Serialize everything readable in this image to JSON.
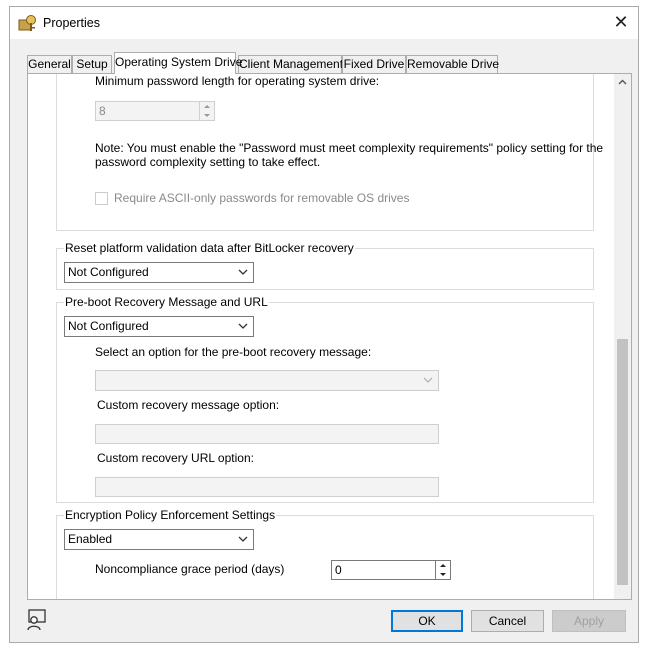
{
  "window": {
    "title": "Properties",
    "close_label": "✕"
  },
  "tabs": [
    {
      "label": "General"
    },
    {
      "label": "Setup"
    },
    {
      "label": "Operating System Drive"
    },
    {
      "label": "Client Management"
    },
    {
      "label": "Fixed Drive"
    },
    {
      "label": "Removable Drive"
    }
  ],
  "password": {
    "label": "Minimum password length for operating system drive:",
    "value": "8",
    "note": "Note: You must enable the \"Password must meet complexity requirements\" policy setting for the password complexity setting to take effect.",
    "ascii_checkbox_label": "Require ASCII-only passwords for removable OS drives"
  },
  "reset_platform": {
    "legend": "Reset platform validation data after BitLocker recovery",
    "value": "Not Configured"
  },
  "preboot": {
    "legend": "Pre-boot Recovery Message and URL",
    "value": "Not Configured",
    "select_label": "Select an option for the pre-boot recovery message:",
    "select_value": "",
    "message_label": "Custom recovery message option:",
    "message_value": "",
    "url_label": "Custom recovery URL option:",
    "url_value": ""
  },
  "encryption": {
    "legend": "Encryption Policy Enforcement Settings",
    "value": "Enabled",
    "grace_label": "Noncompliance grace period (days)",
    "grace_value": "0"
  },
  "buttons": {
    "ok": "OK",
    "cancel": "Cancel",
    "apply": "Apply"
  },
  "icons": [
    "properties-app-icon",
    "close-icon",
    "chevron-down-icon",
    "spin-up-icon",
    "spin-down-icon",
    "scroll-up-icon",
    "help-feedback-icon"
  ]
}
